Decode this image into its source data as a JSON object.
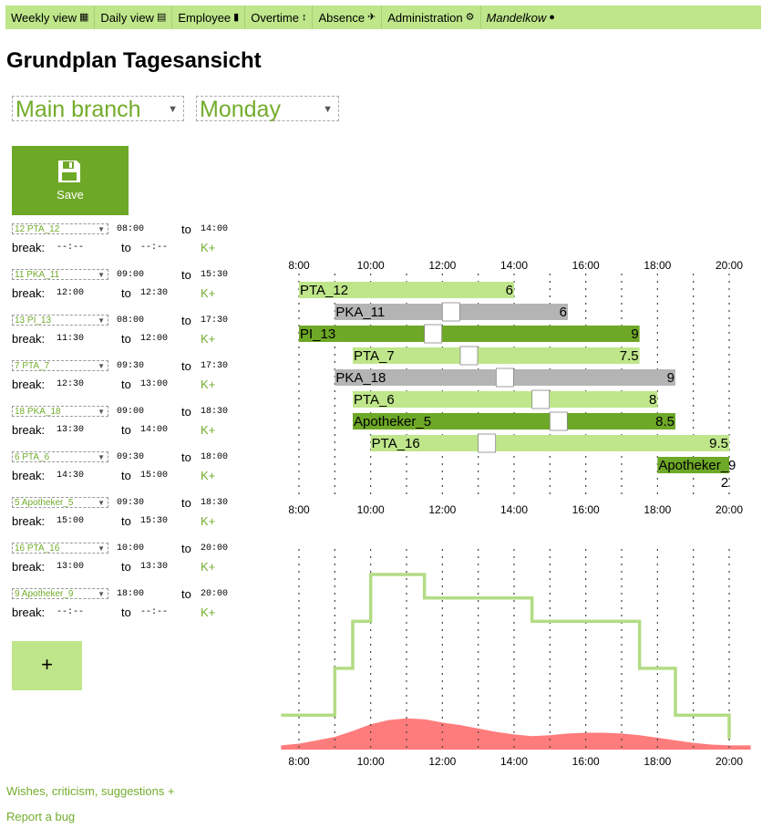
{
  "nav": {
    "items": [
      {
        "label": "Weekly view",
        "icon": "▦"
      },
      {
        "label": "Daily view",
        "icon": "▤"
      },
      {
        "label": "Employee",
        "icon": "▮"
      },
      {
        "label": "Overtime",
        "icon": "↕"
      },
      {
        "label": "Absence",
        "icon": "✈"
      },
      {
        "label": "Administration",
        "icon": "⚙"
      }
    ],
    "user": "Mandelkow",
    "user_icon": "👤"
  },
  "page": {
    "title": "Grundplan Tagesansicht"
  },
  "filters": {
    "branch": "Main branch",
    "day": "Monday"
  },
  "toolbar": {
    "save_label": "Save",
    "add_label": "+"
  },
  "labels": {
    "to": "to",
    "break": "break:",
    "kplus": "K+"
  },
  "roster": [
    {
      "employee": "12 PTA_12",
      "start": "08:00",
      "end": "14:00",
      "break_start": "--:--",
      "break_end": "--:--"
    },
    {
      "employee": "11 PKA_11",
      "start": "09:00",
      "end": "15:30",
      "break_start": "12:00",
      "break_end": "12:30"
    },
    {
      "employee": "13 PI_13",
      "start": "08:00",
      "end": "17:30",
      "break_start": "11:30",
      "break_end": "12:00"
    },
    {
      "employee": "7 PTA_7",
      "start": "09:30",
      "end": "17:30",
      "break_start": "12:30",
      "break_end": "13:00"
    },
    {
      "employee": "18 PKA_18",
      "start": "09:00",
      "end": "18:30",
      "break_start": "13:30",
      "break_end": "14:00"
    },
    {
      "employee": "6 PTA_6",
      "start": "09:30",
      "end": "18:00",
      "break_start": "14:30",
      "break_end": "15:00"
    },
    {
      "employee": "5 Apotheker_5",
      "start": "09:30",
      "end": "18:30",
      "break_start": "15:00",
      "break_end": "15:30"
    },
    {
      "employee": "16 PTA_16",
      "start": "10:00",
      "end": "20:00",
      "break_start": "13:00",
      "break_end": "13:30"
    },
    {
      "employee": "9 Apotheker_9",
      "start": "18:00",
      "end": "20:00",
      "break_start": "--:--",
      "break_end": "--:--"
    }
  ],
  "chart_data": [
    {
      "type": "gantt",
      "x_ticks": [
        "8:00",
        "10:00",
        "12:00",
        "14:00",
        "16:00",
        "18:00",
        "20:00"
      ],
      "x_range": [
        8,
        20
      ],
      "bars": [
        {
          "name": "PTA_12",
          "start": 8.0,
          "end": 14.0,
          "hours": "6",
          "color": "#bfe68a",
          "break": null
        },
        {
          "name": "PKA_11",
          "start": 9.0,
          "end": 15.5,
          "hours": "6",
          "color": "#b4b4b4",
          "break": 12.0
        },
        {
          "name": "PI_13",
          "start": 8.0,
          "end": 17.5,
          "hours": "9",
          "color": "#6ea827",
          "break": 11.5
        },
        {
          "name": "PTA_7",
          "start": 9.5,
          "end": 17.5,
          "hours": "7.5",
          "color": "#bfe68a",
          "break": 12.5
        },
        {
          "name": "PKA_18",
          "start": 9.0,
          "end": 18.5,
          "hours": "9",
          "color": "#b4b4b4",
          "break": 13.5
        },
        {
          "name": "PTA_6",
          "start": 9.5,
          "end": 18.0,
          "hours": "8",
          "color": "#bfe68a",
          "break": 14.5
        },
        {
          "name": "Apotheker_5",
          "start": 9.5,
          "end": 18.5,
          "hours": "8.5",
          "color": "#6ea827",
          "break": 15.0
        },
        {
          "name": "PTA_16",
          "start": 10.0,
          "end": 20.0,
          "hours": "9.5",
          "color": "#bfe68a",
          "break": 13.0
        },
        {
          "name": "Apotheker_9",
          "start": 18.0,
          "end": 20.0,
          "hours": "2",
          "color": "#6ea827",
          "break": null
        }
      ]
    },
    {
      "type": "area",
      "x_ticks": [
        "8:00",
        "10:00",
        "12:00",
        "14:00",
        "16:00",
        "18:00",
        "20:00"
      ],
      "x_range": [
        8,
        20
      ],
      "staffing_step": [
        [
          7.5,
          1
        ],
        [
          8,
          1
        ],
        [
          9,
          3
        ],
        [
          9.5,
          5
        ],
        [
          10,
          7
        ],
        [
          11.5,
          6
        ],
        [
          14.5,
          5
        ],
        [
          17.5,
          3
        ],
        [
          18.5,
          1
        ],
        [
          20,
          0
        ]
      ],
      "demand_curve": [
        [
          7.5,
          0.25
        ],
        [
          8,
          0.35
        ],
        [
          8.5,
          0.55
        ],
        [
          9,
          0.75
        ],
        [
          9.5,
          1.1
        ],
        [
          10,
          1.5
        ],
        [
          10.5,
          1.75
        ],
        [
          11,
          1.85
        ],
        [
          11.5,
          1.8
        ],
        [
          12,
          1.6
        ],
        [
          12.5,
          1.45
        ],
        [
          13,
          1.25
        ],
        [
          13.5,
          1.05
        ],
        [
          14,
          0.9
        ],
        [
          14.5,
          0.8
        ],
        [
          15,
          0.85
        ],
        [
          15.5,
          0.95
        ],
        [
          16,
          1.0
        ],
        [
          16.5,
          1.0
        ],
        [
          17,
          0.95
        ],
        [
          17.5,
          0.85
        ],
        [
          18,
          0.7
        ],
        [
          18.5,
          0.55
        ],
        [
          19,
          0.4
        ],
        [
          19.5,
          0.3
        ],
        [
          20,
          0.25
        ],
        [
          20.6,
          0.25
        ]
      ],
      "colors": {
        "staffing": "#b3dc84",
        "demand": "#ff7c7c"
      }
    }
  ],
  "footer": {
    "feedback": "Wishes, criticism, suggestions +",
    "bug": "Report a bug"
  }
}
